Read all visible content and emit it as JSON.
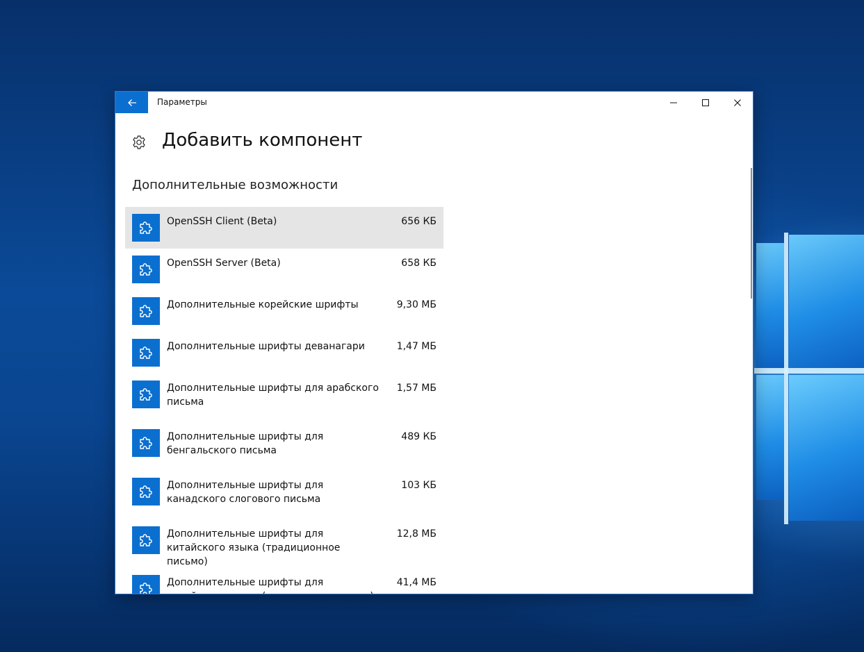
{
  "window": {
    "app_title": "Параметры",
    "back_icon": "back-arrow-icon",
    "controls": [
      "minimize-icon",
      "maximize-icon",
      "close-icon"
    ],
    "accent_color": "#0b6fd0"
  },
  "page": {
    "icon": "gear-icon",
    "title": "Добавить компонент",
    "section_title": "Дополнительные возможности"
  },
  "features": [
    {
      "name": "OpenSSH Client (Beta)",
      "size": "656 КБ",
      "selected": true
    },
    {
      "name": "OpenSSH Server (Beta)",
      "size": "658 КБ"
    },
    {
      "name": "Дополнительные корейские шрифты",
      "size": "9,30 МБ"
    },
    {
      "name": "Дополнительные шрифты деванагари",
      "size": "1,47 МБ"
    },
    {
      "name": "Дополнительные шрифты для арабского письма",
      "size": "1,57 МБ"
    },
    {
      "name": "Дополнительные шрифты для бенгальского письма",
      "size": "489 КБ"
    },
    {
      "name": "Дополнительные шрифты для канадского слогового письма",
      "size": "103 КБ"
    },
    {
      "name": "Дополнительные шрифты для китайского языка (традиционное письмо)",
      "size": "12,8 МБ"
    },
    {
      "name": "Дополнительные шрифты для китайского языка (упрощенное письмо)",
      "size": "41,4 МБ"
    }
  ],
  "feature_icon": "puzzle-piece-icon"
}
